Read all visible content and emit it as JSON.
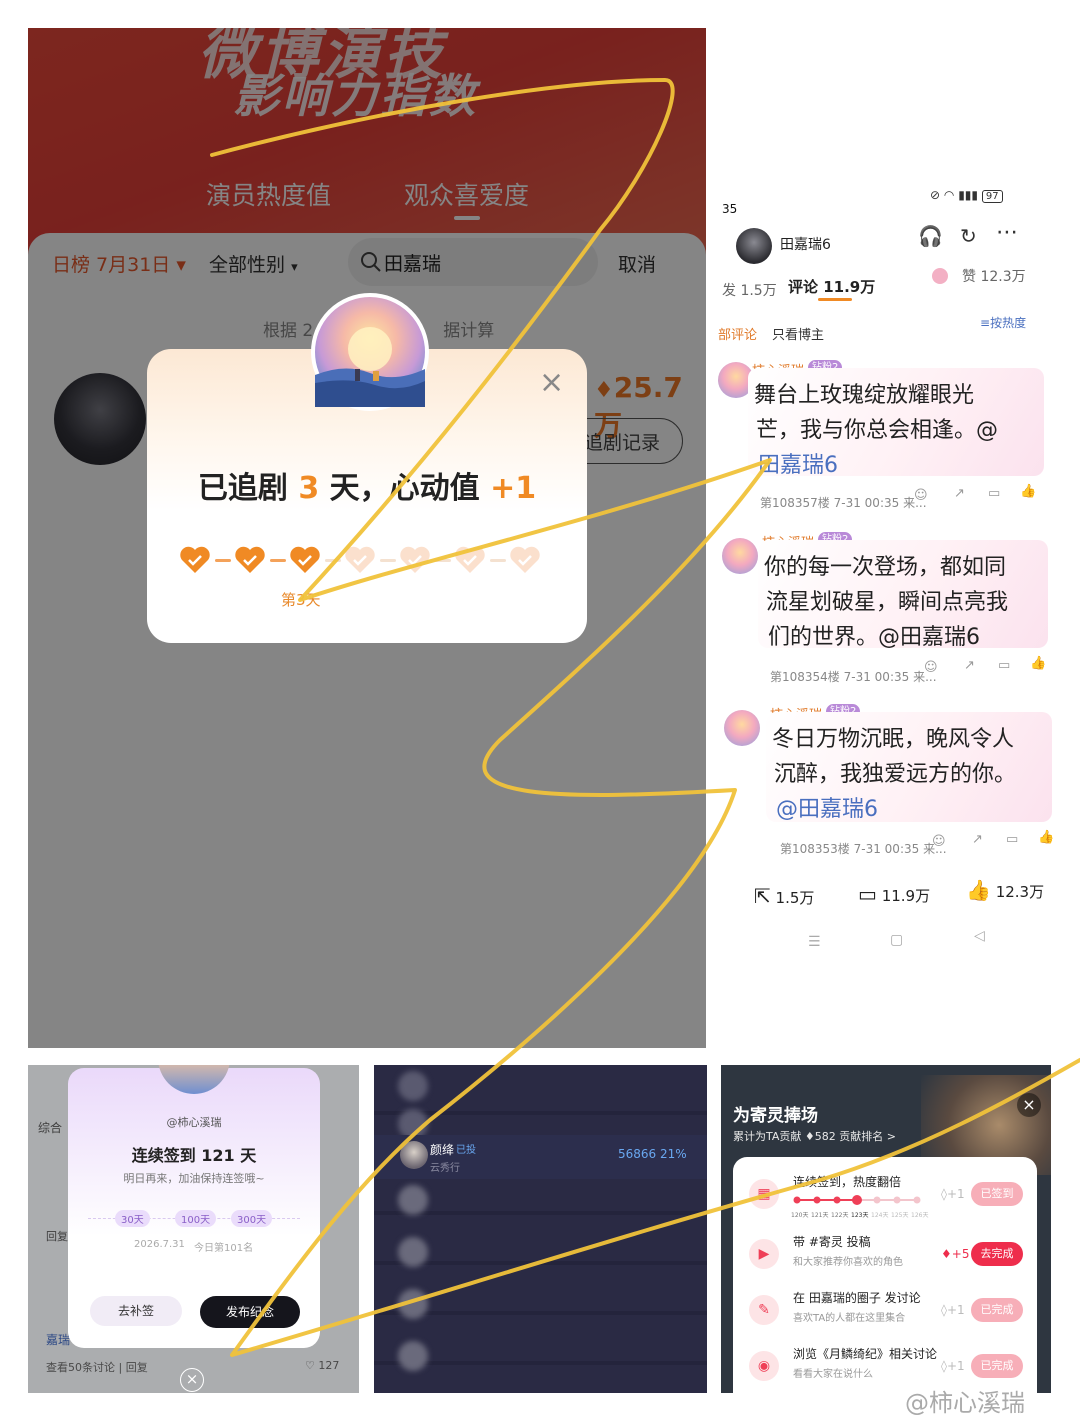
{
  "panel_a": {
    "banner": {
      "title1": "微博演技",
      "title2": "影响力指数",
      "tabs": [
        "演员热度值",
        "观众喜爱度"
      ]
    },
    "filters": {
      "date": "日榜 7月31日",
      "gender": "全部性别",
      "search_value": "田嘉瑞",
      "cancel": "取消"
    },
    "note": "根据 2",
    "note_tail": "据计算",
    "score": "25.7万",
    "record_button": "追剧记录",
    "modal": {
      "title_pre": "已追剧 ",
      "days": "3",
      "title_mid": " 天，心动值 ",
      "plus": "+1",
      "day_label": "第3天",
      "close": "×"
    }
  },
  "panel_b": {
    "status_time": "35",
    "battery": "97",
    "username": "田嘉瑞6",
    "listen": "听",
    "tabs": {
      "repost": "发 1.5万",
      "comments": "评论 11.9万",
      "likes": "赞 12.3万"
    },
    "filter": {
      "all": "部评论",
      "host_only": "只看博主",
      "sort": "按热度"
    },
    "comments": [
      {
        "user": "柿心溪瑞",
        "badge": "钻粉2",
        "text1": "舞台上玫瑰绽放耀眼光",
        "text2": "芒，我与你总会相逢。@",
        "text3": "田嘉瑞6",
        "meta": "第108357楼 7-31 00:35 来..."
      },
      {
        "user": "柿心溪瑞",
        "badge": "钻粉2",
        "text1": "你的每一次登场，都如同",
        "text2": "流星划破星，瞬间点亮我",
        "text3": "们的世界。@田嘉瑞6",
        "meta": "第108354楼 7-31 00:35 来..."
      },
      {
        "user": "柿心溪瑞",
        "badge": "钻粉2",
        "text1": "冬日万物沉眠，晚风令人",
        "text2": "沉醉，我独爱远方的你。",
        "text3": "@田嘉瑞6",
        "meta": "第108353楼 7-31 00:35 来..."
      }
    ],
    "bottom": {
      "share": "1.5万",
      "comment": "11.9万",
      "like": "12.3万"
    }
  },
  "panel_c": {
    "username": "@柿心溪瑞",
    "title": "连续签到 121 天",
    "subtitle": "明日再来，加油保持连签哦~",
    "milestones": [
      "30天",
      "100天",
      "300天"
    ],
    "date": "2026.7.31",
    "rank": "今日第101名",
    "btn_makeup": "去补签",
    "btn_publish": "发布纪念",
    "bg_tab": "综合",
    "bg_reply": "回复",
    "bg_link": "查看50条讨论",
    "bg_reply2": "回复",
    "bg_name": "嘉瑞",
    "bg_count": "127",
    "close": "×"
  },
  "panel_d": {
    "name": "颜绛",
    "tag": "已投",
    "sub": "云秀行",
    "value": "56866",
    "percent": "21%"
  },
  "panel_e": {
    "title": "为寄灵捧场",
    "subtitle_pre": "累计为TA贡献 ",
    "subtitle_val": "582",
    "subtitle_link": "贡献排名 >",
    "close": "×",
    "streak_days": [
      "120天",
      "121天",
      "122天",
      "123天",
      "124天",
      "125天",
      "126天"
    ],
    "tasks": [
      {
        "name": "连续签到，热度翻倍",
        "sub": "",
        "points": "+1",
        "button": "已签到"
      },
      {
        "name": "带 #寄灵 投稿",
        "sub": "和大家推荐你喜欢的角色",
        "points": "+5",
        "button": "去完成"
      },
      {
        "name": "在 田嘉瑞的圈子 发讨论",
        "sub": "喜欢TA的人都在这里集合",
        "points": "+1",
        "button": "已完成"
      },
      {
        "name": "浏览《月鳞绮纪》相关讨论",
        "sub": "看看大家在说什么",
        "points": "+1",
        "button": "已完成"
      }
    ]
  },
  "watermark": "@柿心溪瑞",
  "colors": {
    "accent_orange": "#f08a24",
    "banner_red": "#e8403a",
    "weibo_orange": "#e07a2a",
    "task_red": "#ee2d4c",
    "annotation_yellow": "#f0c23a"
  }
}
